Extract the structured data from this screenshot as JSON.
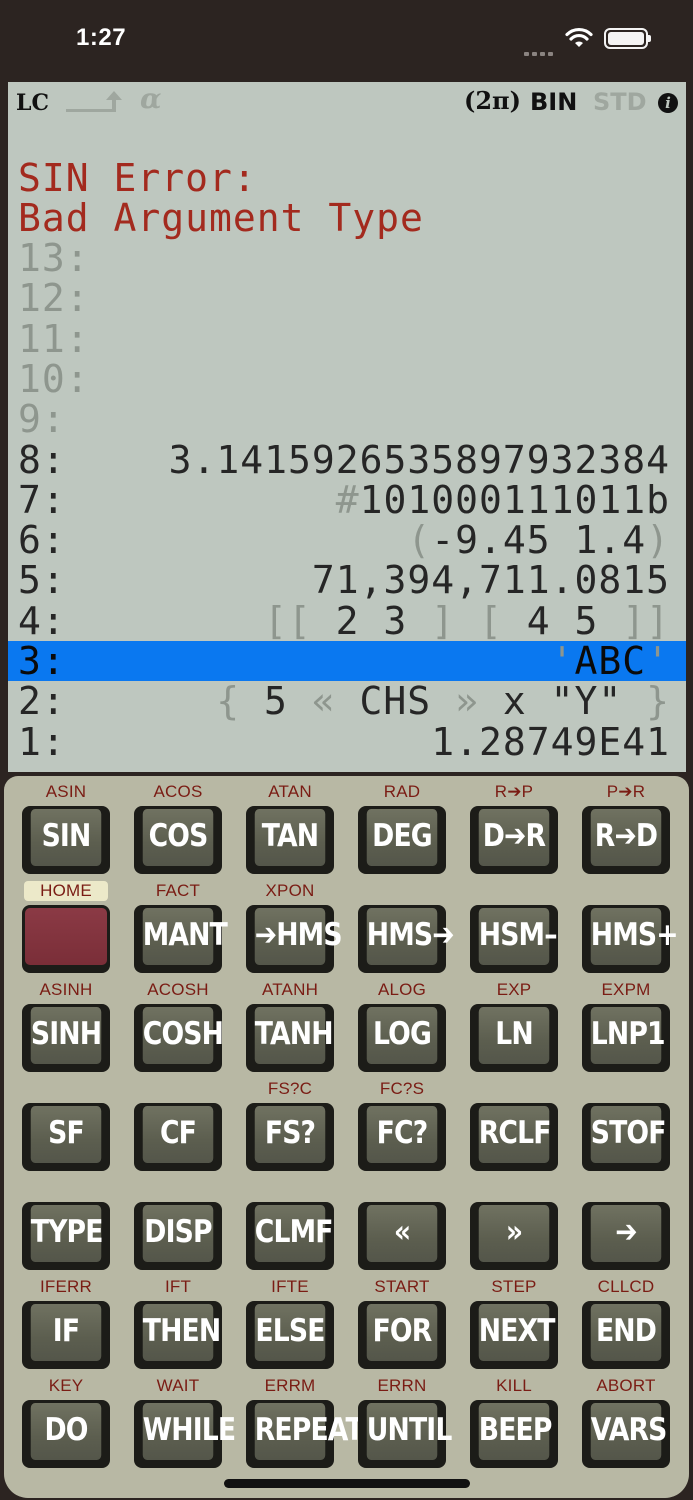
{
  "status": {
    "time": "1:27"
  },
  "annunciators": {
    "lc": "LC",
    "alpha": "α",
    "angle": "(2π)",
    "base": "BIN",
    "mode": "STD",
    "info": "i"
  },
  "error": {
    "line1": "SIN Error:",
    "line2": "Bad Argument Type"
  },
  "stack": [
    {
      "label": "13:",
      "value": ""
    },
    {
      "label": "12:",
      "value": ""
    },
    {
      "label": "11:",
      "value": ""
    },
    {
      "label": "10:",
      "value": ""
    },
    {
      "label": "9:",
      "value": ""
    },
    {
      "label": "8:",
      "value": "3.1415926535897932384"
    },
    {
      "label": "7:",
      "value": "#101000111011b"
    },
    {
      "label": "6:",
      "value": "(-9.45 1.4)"
    },
    {
      "label": "5:",
      "value": "71,394,711.0815"
    },
    {
      "label": "4:",
      "value": "[[ 2 3 ] [ 4 5 ]]"
    },
    {
      "label": "3:",
      "value": "'ABC'"
    },
    {
      "label": "2:",
      "value": "{ 5 « CHS » x \"Y\" }"
    },
    {
      "label": "1:",
      "value": "1.28749E41"
    }
  ],
  "keys": [
    [
      {
        "label": "SIN",
        "shift": "ASIN"
      },
      {
        "label": "COS",
        "shift": "ACOS"
      },
      {
        "label": "TAN",
        "shift": "ATAN"
      },
      {
        "label": "DEG",
        "shift": "RAD"
      },
      {
        "label": "D➔R",
        "shift": "R➔P"
      },
      {
        "label": "R➔D",
        "shift": "P➔R"
      }
    ],
    [
      {
        "label": "",
        "shift": "HOME"
      },
      {
        "label": "MANT",
        "shift": "FACT"
      },
      {
        "label": "➔HMS",
        "shift": "XPON"
      },
      {
        "label": "HMS➔",
        "shift": ""
      },
      {
        "label": "HSM–",
        "shift": ""
      },
      {
        "label": "HMS+",
        "shift": ""
      }
    ],
    [
      {
        "label": "SINH",
        "shift": "ASINH"
      },
      {
        "label": "COSH",
        "shift": "ACOSH"
      },
      {
        "label": "TANH",
        "shift": "ATANH"
      },
      {
        "label": "LOG",
        "shift": "ALOG"
      },
      {
        "label": "LN",
        "shift": "EXP"
      },
      {
        "label": "LNP1",
        "shift": "EXPM"
      }
    ],
    [
      {
        "label": "SF",
        "shift": ""
      },
      {
        "label": "CF",
        "shift": ""
      },
      {
        "label": "FS?",
        "shift": "FS?C"
      },
      {
        "label": "FC?",
        "shift": "FC?S"
      },
      {
        "label": "RCLF",
        "shift": ""
      },
      {
        "label": "STOF",
        "shift": ""
      }
    ],
    [
      {
        "label": "TYPE",
        "shift": ""
      },
      {
        "label": "DISP",
        "shift": ""
      },
      {
        "label": "CLMF",
        "shift": ""
      },
      {
        "label": "«",
        "shift": ""
      },
      {
        "label": "»",
        "shift": ""
      },
      {
        "label": "➔",
        "shift": ""
      }
    ],
    [
      {
        "label": "IF",
        "shift": "IFERR"
      },
      {
        "label": "THEN",
        "shift": "IFT"
      },
      {
        "label": "ELSE",
        "shift": "IFTE"
      },
      {
        "label": "FOR",
        "shift": "START"
      },
      {
        "label": "NEXT",
        "shift": "STEP"
      },
      {
        "label": "END",
        "shift": "CLLCD"
      }
    ],
    [
      {
        "label": "DO",
        "shift": "KEY"
      },
      {
        "label": "WHILE",
        "shift": "WAIT"
      },
      {
        "label": "REPEAT",
        "shift": "ERRM"
      },
      {
        "label": "UNTIL",
        "shift": "ERRN"
      },
      {
        "label": "BEEP",
        "shift": "KILL"
      },
      {
        "label": "VARS",
        "shift": "ABORT"
      }
    ]
  ]
}
